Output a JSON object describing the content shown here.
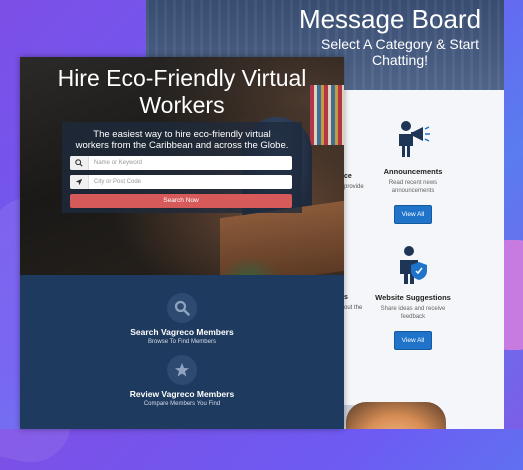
{
  "message_board": {
    "title": "Message Board",
    "subtitle": "Select A Category & Start Chatting!",
    "categories": [
      {
        "icon": "megaphone-person-icon",
        "title": "Announcements",
        "description_line1": "Read recent news",
        "description_line2": "announcements",
        "button_label": "View All"
      },
      {
        "icon": "shield-person-icon",
        "title": "Website Suggestions",
        "description_line1": "Share ideas and receive",
        "description_line2": "feedback",
        "button_label": "View All"
      }
    ],
    "cut_fragments": {
      "ce": "ce",
      "provide": "provide",
      "s": "s",
      "out_the": "out the"
    }
  },
  "hire_panel": {
    "hero_title_line1": "Hire Eco-Friendly Virtual",
    "hero_title_line2": "Workers",
    "tagline_line1": "The easiest way to hire eco-friendly virtual",
    "tagline_line2": "workers from the Caribbean and across the Globe.",
    "keyword_placeholder": "Name or Keyword",
    "location_placeholder": "City or Post Code",
    "search_button": "Search Now",
    "features": [
      {
        "icon": "search-icon",
        "title": "Search Vagreco Members",
        "subtitle": "Browse To Find Members"
      },
      {
        "icon": "star-icon",
        "title": "Review Vagreco Members",
        "subtitle": "Compare Members You Find"
      }
    ]
  },
  "colors": {
    "accent_blue": "#1f74c9",
    "search_red": "#d75a5a",
    "navy": "#1e3a5f",
    "background_purple": "#7d4fe6"
  }
}
